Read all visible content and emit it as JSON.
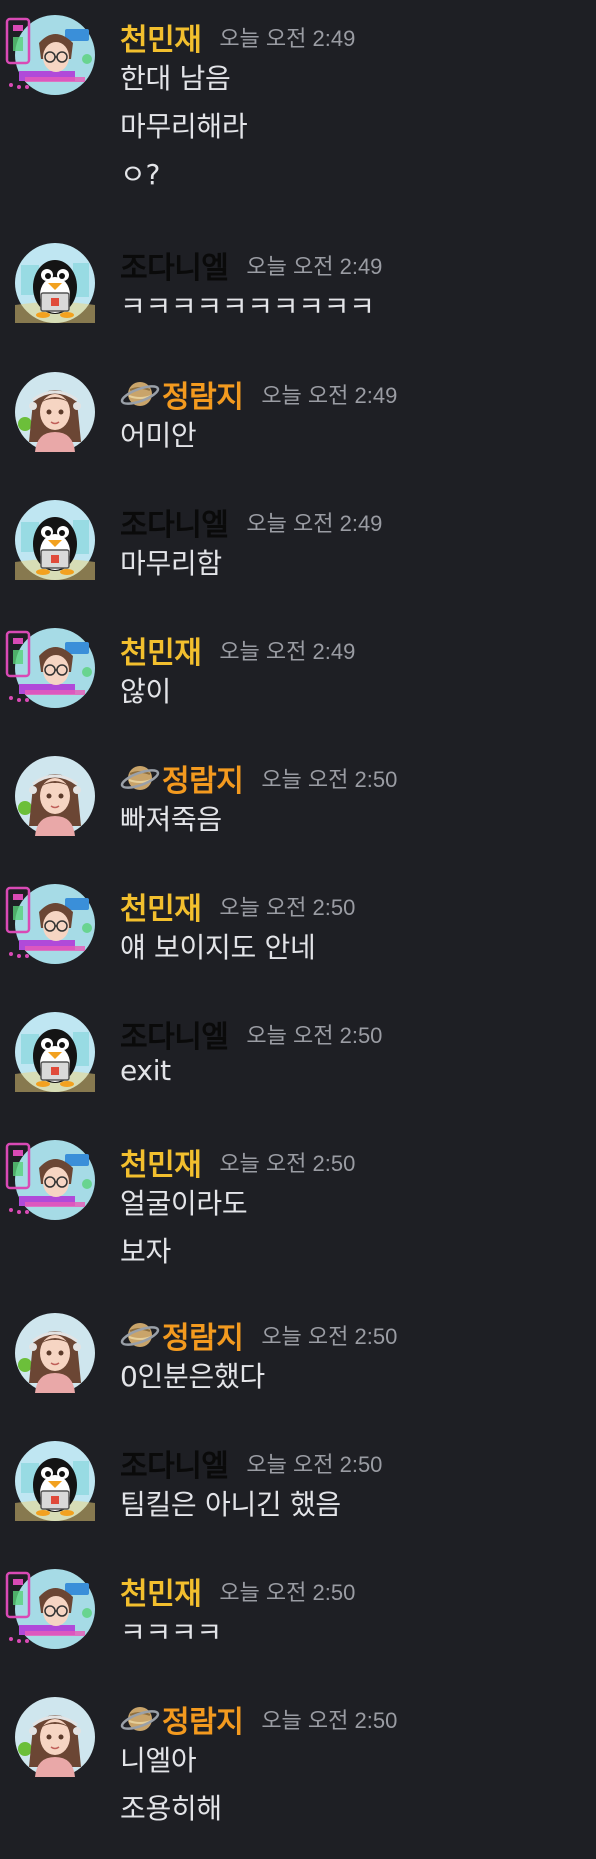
{
  "colors": {
    "background": "#1e1f24",
    "name_cheon": "#f2bf2e",
    "name_jeong": "#f39a1f",
    "name_jo": "#0a0a0a",
    "timestamp": "#9a9ca3",
    "text": "#e3e4e8"
  },
  "messages": [
    {
      "author": "천민재",
      "avatar": "anime-glasses",
      "badge": false,
      "time": "오늘 오전 2:49",
      "lines": [
        "한대 남음",
        "마무리해라",
        "ㅇ?"
      ]
    },
    {
      "author": "조다니엘",
      "avatar": "penguin",
      "badge": false,
      "time": "오늘 오전 2:49",
      "lines": [
        "ㅋㅋㅋㅋㅋㅋㅋㅋㅋㅋ"
      ]
    },
    {
      "author": "정람지",
      "avatar": "anime-girl",
      "badge": true,
      "time": "오늘 오전 2:49",
      "lines": [
        "어미안"
      ]
    },
    {
      "author": "조다니엘",
      "avatar": "penguin",
      "badge": false,
      "time": "오늘 오전 2:49",
      "lines": [
        "마무리함"
      ]
    },
    {
      "author": "천민재",
      "avatar": "anime-glasses",
      "badge": false,
      "time": "오늘 오전 2:49",
      "lines": [
        "않이"
      ]
    },
    {
      "author": "정람지",
      "avatar": "anime-girl",
      "badge": true,
      "time": "오늘 오전 2:50",
      "lines": [
        "빠져죽음"
      ]
    },
    {
      "author": "천민재",
      "avatar": "anime-glasses",
      "badge": false,
      "time": "오늘 오전 2:50",
      "lines": [
        "얘 보이지도 안네"
      ]
    },
    {
      "author": "조다니엘",
      "avatar": "penguin",
      "badge": false,
      "time": "오늘 오전 2:50",
      "lines": [
        "exit"
      ]
    },
    {
      "author": "천민재",
      "avatar": "anime-glasses",
      "badge": false,
      "time": "오늘 오전 2:50",
      "lines": [
        "얼굴이라도",
        "보자"
      ]
    },
    {
      "author": "정람지",
      "avatar": "anime-girl",
      "badge": true,
      "time": "오늘 오전 2:50",
      "lines": [
        "0인분은했다"
      ]
    },
    {
      "author": "조다니엘",
      "avatar": "penguin",
      "badge": false,
      "time": "오늘 오전 2:50",
      "lines": [
        "팀킬은 아니긴 했음"
      ]
    },
    {
      "author": "천민재",
      "avatar": "anime-glasses",
      "badge": false,
      "time": "오늘 오전 2:50",
      "lines": [
        "ㅋㅋㅋㅋ"
      ]
    },
    {
      "author": "정람지",
      "avatar": "anime-girl",
      "badge": true,
      "time": "오늘 오전 2:50",
      "lines": [
        "니엘아",
        "조용히해"
      ]
    }
  ]
}
